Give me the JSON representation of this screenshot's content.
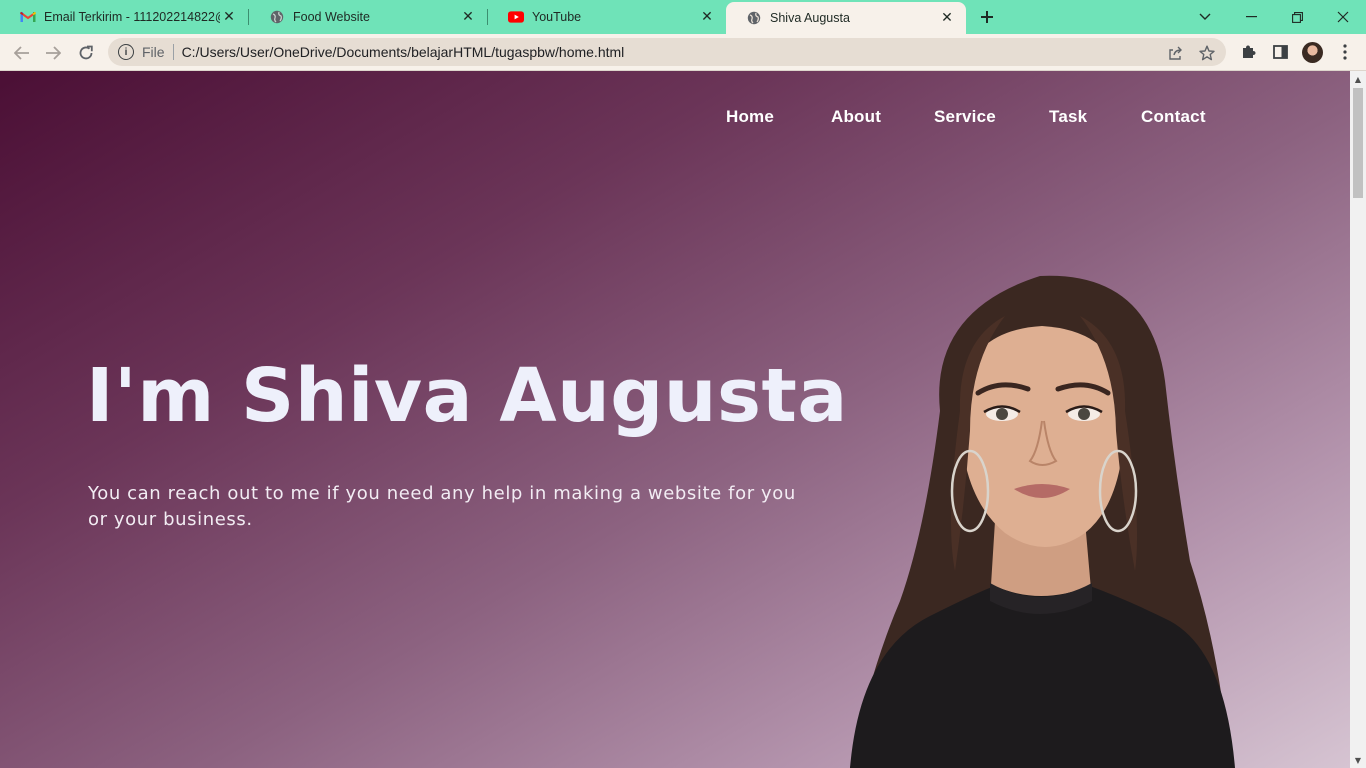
{
  "browser": {
    "tabs": [
      {
        "title": "Email Terkirim - 111202214822@",
        "icon": "gmail-icon",
        "active": false
      },
      {
        "title": "Food Website",
        "icon": "globe-icon",
        "active": false
      },
      {
        "title": "YouTube",
        "icon": "youtube-icon",
        "active": false
      },
      {
        "title": "Shiva Augusta",
        "icon": "globe-icon",
        "active": true
      }
    ],
    "address_bar": {
      "scheme": "File",
      "url": "C:/Users/User/OneDrive/Documents/belajarHTML/tugaspbw/home.html"
    },
    "colors": {
      "tabstrip": "#6fe3b8",
      "toolbar": "#f7f1ea"
    }
  },
  "page": {
    "nav": {
      "items": [
        "Home",
        "About",
        "Service",
        "Task",
        "Contact"
      ]
    },
    "hero": {
      "title": "I'm Shiva Augusta",
      "subtitle": "You can reach out to me if you need any help in making a website for you or your business."
    },
    "colors": {
      "gradient_start": "#4b0f35",
      "gradient_end": "#d6c4d2",
      "title": "#eef0fb"
    }
  }
}
